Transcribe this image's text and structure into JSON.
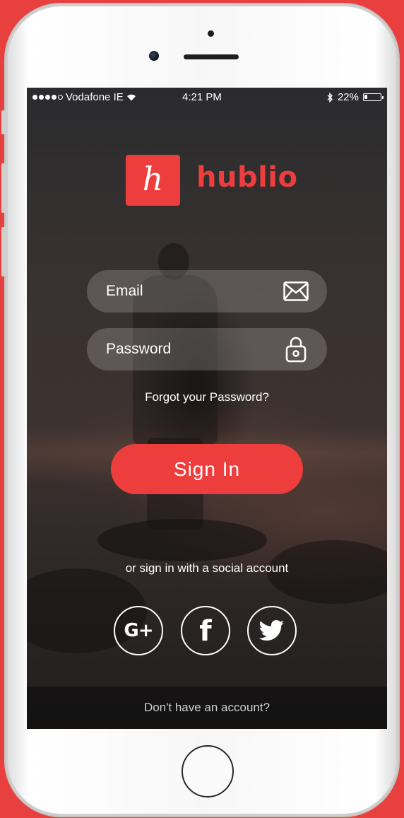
{
  "status_bar": {
    "carrier": "Vodafone IE",
    "time": "4:21 PM",
    "battery": "22%",
    "battery_level": 0.22,
    "signal_bars": 4,
    "icons": [
      "wifi-icon",
      "bluetooth-icon",
      "battery-icon"
    ]
  },
  "brand": {
    "logo_letter": "h",
    "name": "hublio",
    "accent_color": "#ee3d3d"
  },
  "login_form": {
    "email_placeholder": "Email",
    "email_icon": "envelope-icon",
    "password_placeholder": "Password",
    "password_icon": "lock-icon",
    "forgot_link": "Forgot your Password?",
    "signin_label": "Sign In"
  },
  "social": {
    "prompt": "or sign in with a social account",
    "providers": [
      {
        "name": "google-plus",
        "label": "G+"
      },
      {
        "name": "facebook",
        "label": "f"
      },
      {
        "name": "twitter",
        "label": ""
      }
    ]
  },
  "footer": {
    "signup_prompt": "Don't have an account?"
  }
}
